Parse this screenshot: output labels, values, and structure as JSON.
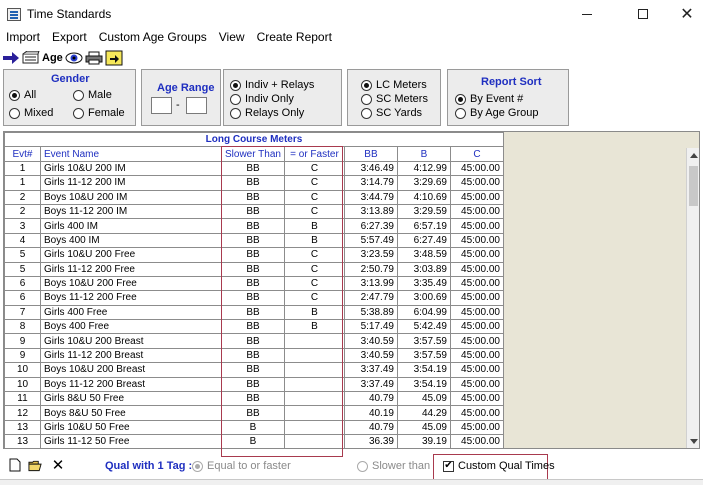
{
  "window": {
    "title": "Time Standards"
  },
  "menu": [
    "Import",
    "Export",
    "Custom Age Groups",
    "View",
    "Create Report"
  ],
  "toolbar": {
    "age_label": "Age"
  },
  "gender": {
    "title": "Gender",
    "all": "All",
    "male": "Male",
    "mixed": "Mixed",
    "female": "Female",
    "selected": "All"
  },
  "age_range": {
    "title": "Age Range",
    "separator": "-",
    "from": "",
    "to": ""
  },
  "event_type": {
    "indiv_relays": "Indiv + Relays",
    "indiv_only": "Indiv Only",
    "relays_only": "Relays Only",
    "selected": "Indiv + Relays"
  },
  "course": {
    "lc_meters": "LC Meters",
    "sc_meters": "SC Meters",
    "sc_yards": "SC Yards",
    "selected": "LC Meters"
  },
  "report_sort": {
    "title": "Report Sort",
    "by_event": "By Event #",
    "by_age": "By Age Group",
    "selected": "By Event #"
  },
  "grid": {
    "caption": "Long Course Meters",
    "headers": [
      "Evt#",
      "Event Name",
      "Slower Than",
      "= or Faster",
      "BB",
      "B",
      "C"
    ],
    "rows": [
      [
        "1",
        "Girls 10&U 200 IM",
        "BB",
        "C",
        "3:46.49",
        "4:12.99",
        "45:00.00"
      ],
      [
        "1",
        "Girls 11-12 200 IM",
        "BB",
        "C",
        "3:14.79",
        "3:29.69",
        "45:00.00"
      ],
      [
        "2",
        "Boys 10&U 200 IM",
        "BB",
        "C",
        "3:44.79",
        "4:10.69",
        "45:00.00"
      ],
      [
        "2",
        "Boys 11-12 200 IM",
        "BB",
        "C",
        "3:13.89",
        "3:29.59",
        "45:00.00"
      ],
      [
        "3",
        "Girls 400 IM",
        "BB",
        "B",
        "6:27.39",
        "6:57.19",
        "45:00.00"
      ],
      [
        "4",
        "Boys 400 IM",
        "BB",
        "B",
        "5:57.49",
        "6:27.49",
        "45:00.00"
      ],
      [
        "5",
        "Girls 10&U 200 Free",
        "BB",
        "C",
        "3:23.59",
        "3:48.59",
        "45:00.00"
      ],
      [
        "5",
        "Girls 11-12 200 Free",
        "BB",
        "C",
        "2:50.79",
        "3:03.89",
        "45:00.00"
      ],
      [
        "6",
        "Boys 10&U 200 Free",
        "BB",
        "C",
        "3:13.99",
        "3:35.49",
        "45:00.00"
      ],
      [
        "6",
        "Boys 11-12 200 Free",
        "BB",
        "C",
        "2:47.79",
        "3:00.69",
        "45:00.00"
      ],
      [
        "7",
        "Girls 400 Free",
        "BB",
        "B",
        "5:38.89",
        "6:04.99",
        "45:00.00"
      ],
      [
        "8",
        "Boys 400 Free",
        "BB",
        "B",
        "5:17.49",
        "5:42.49",
        "45:00.00"
      ],
      [
        "9",
        "Girls 10&U 200 Breast",
        "BB",
        "",
        "3:40.59",
        "3:57.59",
        "45:00.00"
      ],
      [
        "9",
        "Girls 11-12 200 Breast",
        "BB",
        "",
        "3:40.59",
        "3:57.59",
        "45:00.00"
      ],
      [
        "10",
        "Boys 10&U 200 Breast",
        "BB",
        "",
        "3:37.49",
        "3:54.19",
        "45:00.00"
      ],
      [
        "10",
        "Boys 11-12 200 Breast",
        "BB",
        "",
        "3:37.49",
        "3:54.19",
        "45:00.00"
      ],
      [
        "11",
        "Girls 8&U 50 Free",
        "BB",
        "",
        "40.79",
        "45.09",
        "45:00.00"
      ],
      [
        "12",
        "Boys 8&U 50 Free",
        "BB",
        "",
        "40.19",
        "44.29",
        "45:00.00"
      ],
      [
        "13",
        "Girls 10&U 50 Free",
        "B",
        "",
        "40.79",
        "45.09",
        "45:00.00"
      ],
      [
        "13",
        "Girls 11-12 50 Free",
        "B",
        "",
        "36.39",
        "39.19",
        "45:00.00"
      ]
    ]
  },
  "bottom": {
    "qual_label": "Qual with 1 Tag :",
    "equal_faster": "Equal to or faster",
    "slower_than": "Slower than",
    "custom_qual": "Custom Qual Times",
    "custom_qual_checked": true
  },
  "colors": {
    "accent_blue": "#1f2fc0",
    "highlight_red": "#a83a4e",
    "grid_empty": "#e8e5d6"
  },
  "icons": [
    "app-icon",
    "arrow-icon",
    "books-icon",
    "eye-icon",
    "printer-icon",
    "export-icon",
    "new-file-icon",
    "open-folder-icon",
    "delete-icon"
  ]
}
